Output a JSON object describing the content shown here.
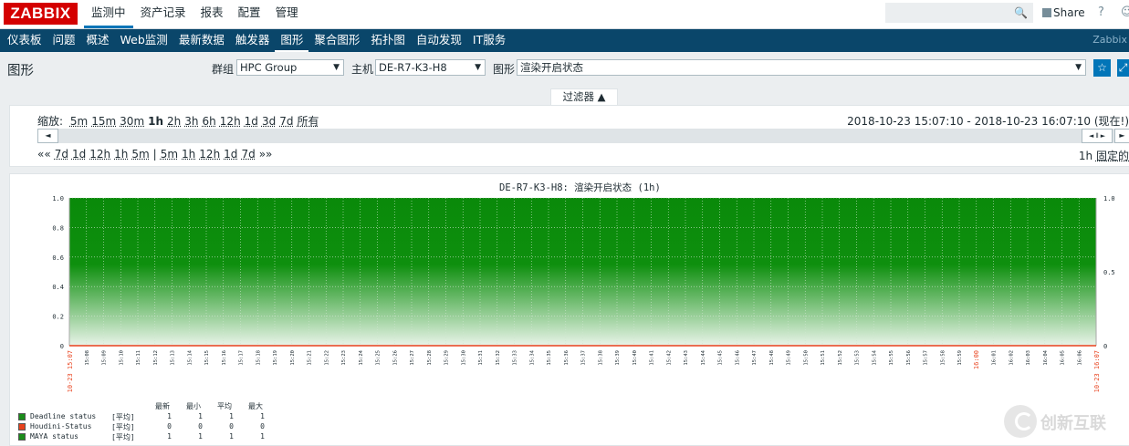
{
  "app": {
    "logo": "ZABBIX"
  },
  "top_menu": [
    {
      "label": "监测中",
      "selected": true
    },
    {
      "label": "资产记录",
      "selected": false
    },
    {
      "label": "报表",
      "selected": false
    },
    {
      "label": "配置",
      "selected": false
    },
    {
      "label": "管理",
      "selected": false
    }
  ],
  "top_right": {
    "share_label": "Share",
    "help_label": "?",
    "search_icon": "search-icon"
  },
  "sub_menu": [
    {
      "label": "仪表板",
      "selected": false
    },
    {
      "label": "问题",
      "selected": false
    },
    {
      "label": "概述",
      "selected": false
    },
    {
      "label": "Web监测",
      "selected": false
    },
    {
      "label": "最新数据",
      "selected": false
    },
    {
      "label": "触发器",
      "selected": false
    },
    {
      "label": "图形",
      "selected": true
    },
    {
      "label": "聚合图形",
      "selected": false
    },
    {
      "label": "拓扑图",
      "selected": false
    },
    {
      "label": "自动发现",
      "selected": false
    },
    {
      "label": "IT服务",
      "selected": false
    }
  ],
  "sub_brand": "Zabbix",
  "page": {
    "title": "图形",
    "group_label": "群组",
    "group_value": "HPC Group",
    "host_label": "主机",
    "host_value": "DE-R7-K3-H8",
    "graph_label": "图形",
    "graph_value": "渲染开启状态"
  },
  "filter": {
    "tab_label": "过滤器 ▲",
    "zoom_label": "缩放:",
    "zoom_options": [
      "5m",
      "15m",
      "30m",
      "1h",
      "2h",
      "3h",
      "6h",
      "12h",
      "1d",
      "3d",
      "7d",
      "所有"
    ],
    "zoom_current": "1h",
    "period_text": "2018-10-23 15:07:10 - 2018-10-23 16:07:10 (现在!)",
    "nav_left": [
      "««",
      "7d",
      "1d",
      "12h",
      "1h",
      "5m",
      "|",
      "5m",
      "1h",
      "12h",
      "1d",
      "7d",
      "»»"
    ],
    "nav_right_period": "1h",
    "nav_right_fixed": "固定的"
  },
  "chart_data": {
    "type": "area",
    "title": "DE-R7-K3-H8: 渲染开启状态 (1h)",
    "x_start_label": "10-23 15:07",
    "x_end_label": "10-23 16:07",
    "x_minutes": [
      "15:08",
      "15:09",
      "15:10",
      "15:11",
      "15:12",
      "15:13",
      "15:14",
      "15:15",
      "15:16",
      "15:17",
      "15:18",
      "15:19",
      "15:20",
      "15:21",
      "15:22",
      "15:23",
      "15:24",
      "15:25",
      "15:26",
      "15:27",
      "15:28",
      "15:29",
      "15:30",
      "15:31",
      "15:32",
      "15:33",
      "15:34",
      "15:35",
      "15:36",
      "15:37",
      "15:38",
      "15:39",
      "15:40",
      "15:41",
      "15:42",
      "15:43",
      "15:44",
      "15:45",
      "15:46",
      "15:47",
      "15:48",
      "15:49",
      "15:50",
      "15:51",
      "15:52",
      "15:53",
      "15:54",
      "15:55",
      "15:56",
      "15:57",
      "15:58",
      "15:59",
      "16:00",
      "16:01",
      "16:02",
      "16:03",
      "16:04",
      "16:05",
      "16:06"
    ],
    "y_left_ticks": [
      "1.0",
      "0.8",
      "0.6",
      "0.4",
      "0.2",
      "0"
    ],
    "y_right_ticks": [
      "1.0",
      "0.5",
      "0"
    ],
    "ylim": [
      0,
      1
    ],
    "series": [
      {
        "name": "Deadline status",
        "values": [
          1,
          1
        ],
        "color": "#1a8c1a"
      },
      {
        "name": "Houdini-Status",
        "values": [
          0,
          0
        ],
        "color": "#e8411c"
      },
      {
        "name": "MAYA status",
        "values": [
          1,
          1
        ],
        "color": "#1a8c1a"
      }
    ],
    "legend": {
      "headers": [
        "最新",
        "最小",
        "平均",
        "最大"
      ],
      "rows": [
        {
          "name": "Deadline status",
          "func": "[平均]",
          "last": "1",
          "min": "1",
          "avg": "1",
          "max": "1",
          "color": "#1a8c1a"
        },
        {
          "name": "Houdini-Status",
          "func": "[平均]",
          "last": "0",
          "min": "0",
          "avg": "0",
          "max": "0",
          "color": "#e8411c"
        },
        {
          "name": "MAYA status",
          "func": "[平均]",
          "last": "1",
          "min": "1",
          "avg": "1",
          "max": "1",
          "color": "#1a8c1a"
        }
      ]
    }
  },
  "watermark": "创新互联"
}
